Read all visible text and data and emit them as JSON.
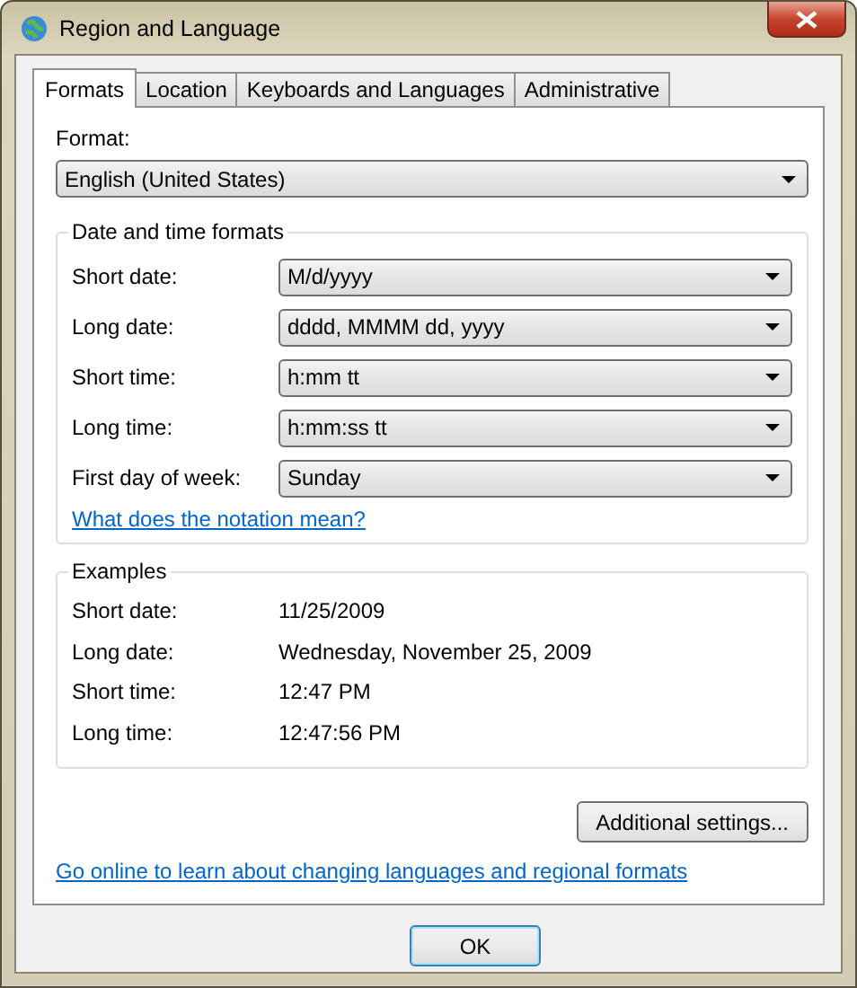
{
  "window": {
    "title": "Region and Language"
  },
  "tabs": [
    {
      "label": "Formats",
      "selected": true
    },
    {
      "label": "Location",
      "selected": false
    },
    {
      "label": "Keyboards and Languages",
      "selected": false
    },
    {
      "label": "Administrative",
      "selected": false
    }
  ],
  "format": {
    "label": "Format:",
    "value": "English (United States)"
  },
  "date_time_formats": {
    "title": "Date and time formats",
    "rows": [
      {
        "label": "Short date:",
        "value": "M/d/yyyy"
      },
      {
        "label": "Long date:",
        "value": "dddd, MMMM dd, yyyy"
      },
      {
        "label": "Short time:",
        "value": "h:mm tt"
      },
      {
        "label": "Long time:",
        "value": "h:mm:ss tt"
      },
      {
        "label": "First day of week:",
        "value": "Sunday"
      }
    ],
    "link": "What does the notation mean?"
  },
  "examples": {
    "title": "Examples",
    "rows": [
      {
        "label": "Short date:",
        "value": "11/25/2009"
      },
      {
        "label": "Long date:",
        "value": "Wednesday, November 25, 2009"
      },
      {
        "label": "Short time:",
        "value": "12:47 PM"
      },
      {
        "label": "Long time:",
        "value": "12:47:56 PM"
      }
    ]
  },
  "additional_button": "Additional settings...",
  "online_link": "Go online to learn about changing languages and regional formats",
  "buttons": [
    {
      "label": "OK",
      "default": true
    }
  ]
}
